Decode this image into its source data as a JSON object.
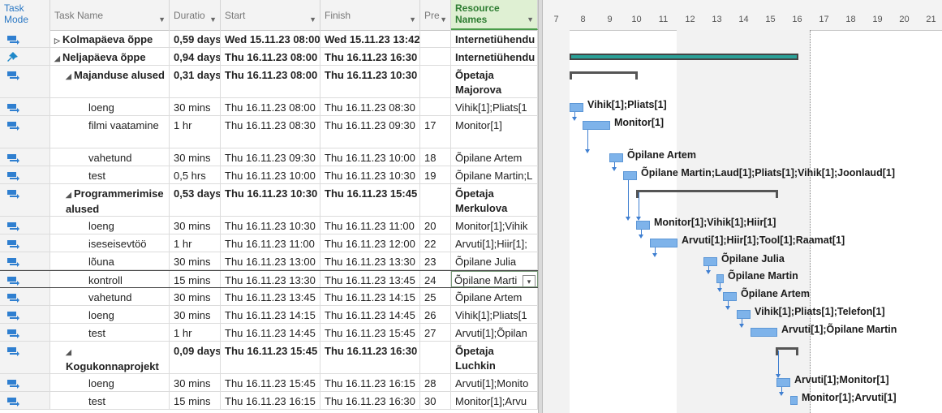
{
  "headers": {
    "task_mode": "Task Mode",
    "task_name": "Task Name",
    "duration": "Duratio",
    "start": "Start",
    "finish": "Finish",
    "pred": "Pre",
    "resource": "Resource Names"
  },
  "timescale": [
    "7",
    "8",
    "9",
    "10",
    "11",
    "12",
    "13",
    "14",
    "15",
    "16",
    "17",
    "18",
    "19",
    "20",
    "21"
  ],
  "rows": [
    {
      "mode": "auto",
      "level": 0,
      "summary": "collapsed",
      "name": "Kolmapäeva õppe",
      "dur": "0,59 days",
      "start": "Wed 15.11.23 08:00",
      "finish": "Wed 15.11.23 13:42",
      "pred": "",
      "res": "Internetiühendu"
    },
    {
      "mode": "manual",
      "level": 0,
      "summary": "expanded",
      "name": "Neljapäeva õppe",
      "dur": "0,94 days",
      "start": "Thu 16.11.23 08:00",
      "finish": "Thu 16.11.23 16:30",
      "pred": "",
      "res": "Internetiühendu"
    },
    {
      "mode": "auto",
      "level": 1,
      "summary": "expanded",
      "name": "Majanduse alused",
      "dur": "0,31 days",
      "start": "Thu 16.11.23 08:00",
      "finish": "Thu 16.11.23 10:30",
      "pred": "",
      "res": "Õpetaja Majorova"
    },
    {
      "mode": "auto",
      "level": 2,
      "name": "loeng",
      "dur": "30 mins",
      "start": "Thu 16.11.23 08:00",
      "finish": "Thu 16.11.23 08:30",
      "pred": "",
      "res": "Vihik[1];Pliats[1"
    },
    {
      "mode": "auto",
      "level": 2,
      "name": "filmi vaatamine",
      "dur": "1 hr",
      "start": "Thu 16.11.23 08:30",
      "finish": "Thu 16.11.23 09:30",
      "pred": "17",
      "res": "Monitor[1]"
    },
    {
      "mode": "auto",
      "level": 2,
      "name": "vahetund",
      "dur": "30 mins",
      "start": "Thu 16.11.23 09:30",
      "finish": "Thu 16.11.23 10:00",
      "pred": "18",
      "res": "Õpilane Artem"
    },
    {
      "mode": "auto",
      "level": 2,
      "name": "test",
      "dur": "0,5 hrs",
      "start": "Thu 16.11.23 10:00",
      "finish": "Thu 16.11.23 10:30",
      "pred": "19",
      "res": "Õpilane Martin;L"
    },
    {
      "mode": "auto",
      "level": 1,
      "summary": "expanded",
      "name": "Programmerimise alused",
      "dur": "0,53 days",
      "start": "Thu 16.11.23 10:30",
      "finish": "Thu 16.11.23 15:45",
      "pred": "",
      "res": "Õpetaja Merkulova"
    },
    {
      "mode": "auto",
      "level": 2,
      "name": "loeng",
      "dur": "30 mins",
      "start": "Thu 16.11.23 10:30",
      "finish": "Thu 16.11.23 11:00",
      "pred": "20",
      "res": "Monitor[1];Vihik"
    },
    {
      "mode": "auto",
      "level": 2,
      "name": "iseseisevtöö",
      "dur": "1 hr",
      "start": "Thu 16.11.23 11:00",
      "finish": "Thu 16.11.23 12:00",
      "pred": "22",
      "res": "Arvuti[1];Hiir[1];"
    },
    {
      "mode": "auto",
      "level": 2,
      "name": "lõuna",
      "dur": "30 mins",
      "start": "Thu 16.11.23 13:00",
      "finish": "Thu 16.11.23 13:30",
      "pred": "23",
      "res": "Õpilane Julia"
    },
    {
      "mode": "auto",
      "level": 2,
      "name": "kontroll",
      "dur": "15 mins",
      "start": "Thu 16.11.23 13:30",
      "finish": "Thu 16.11.23 13:45",
      "pred": "24",
      "res": "Õpilane Marti",
      "selected": true
    },
    {
      "mode": "auto",
      "level": 2,
      "name": "vahetund",
      "dur": "30 mins",
      "start": "Thu 16.11.23 13:45",
      "finish": "Thu 16.11.23 14:15",
      "pred": "25",
      "res": "Õpilane Artem"
    },
    {
      "mode": "auto",
      "level": 2,
      "name": "loeng",
      "dur": "30 mins",
      "start": "Thu 16.11.23 14:15",
      "finish": "Thu 16.11.23 14:45",
      "pred": "26",
      "res": "Vihik[1];Pliats[1"
    },
    {
      "mode": "auto",
      "level": 2,
      "name": "test",
      "dur": "1 hr",
      "start": "Thu 16.11.23 14:45",
      "finish": "Thu 16.11.23 15:45",
      "pred": "27",
      "res": "Arvuti[1];Õpilan"
    },
    {
      "mode": "auto",
      "level": 1,
      "summary": "expanded",
      "name": "Kogukonnaprojekt teostamine",
      "dur": "0,09 days",
      "start": "Thu 16.11.23 15:45",
      "finish": "Thu 16.11.23 16:30",
      "pred": "",
      "res": "Õpetaja Luchkin"
    },
    {
      "mode": "auto",
      "level": 2,
      "name": "loeng",
      "dur": "30 mins",
      "start": "Thu 16.11.23 15:45",
      "finish": "Thu 16.11.23 16:15",
      "pred": "28",
      "res": "Arvuti[1];Monito"
    },
    {
      "mode": "auto",
      "level": 2,
      "name": "test",
      "dur": "15 mins",
      "start": "Thu 16.11.23 16:15",
      "finish": "Thu 16.11.23 16:30",
      "pred": "30",
      "res": "Monitor[1];Arvu"
    }
  ],
  "bar_labels": [
    "Vihik[1];Pliats[1]",
    "Monitor[1]",
    "Õpilane Artem",
    "Õpilane Martin;Laud[1];Pliats[1];Vihik[1];Joonlaud[1]",
    "Monitor[1];Vihik[1];Hiir[1]",
    "Arvuti[1];Hiir[1];Tool[1];Raamat[1]",
    "Õpilane Julia",
    "Õpilane Martin",
    "Õpilane Artem",
    "Vihik[1];Pliats[1];Telefon[1]",
    "Arvuti[1];Õpilane Martin",
    "Arvuti[1];Monitor[1]",
    "Monitor[1];Arvuti[1]"
  ],
  "colors": {
    "accent": "#4a9c4a",
    "bar": "#7eb3ea",
    "summary_bar": "#2aa198",
    "link": "#3f7fd1"
  }
}
